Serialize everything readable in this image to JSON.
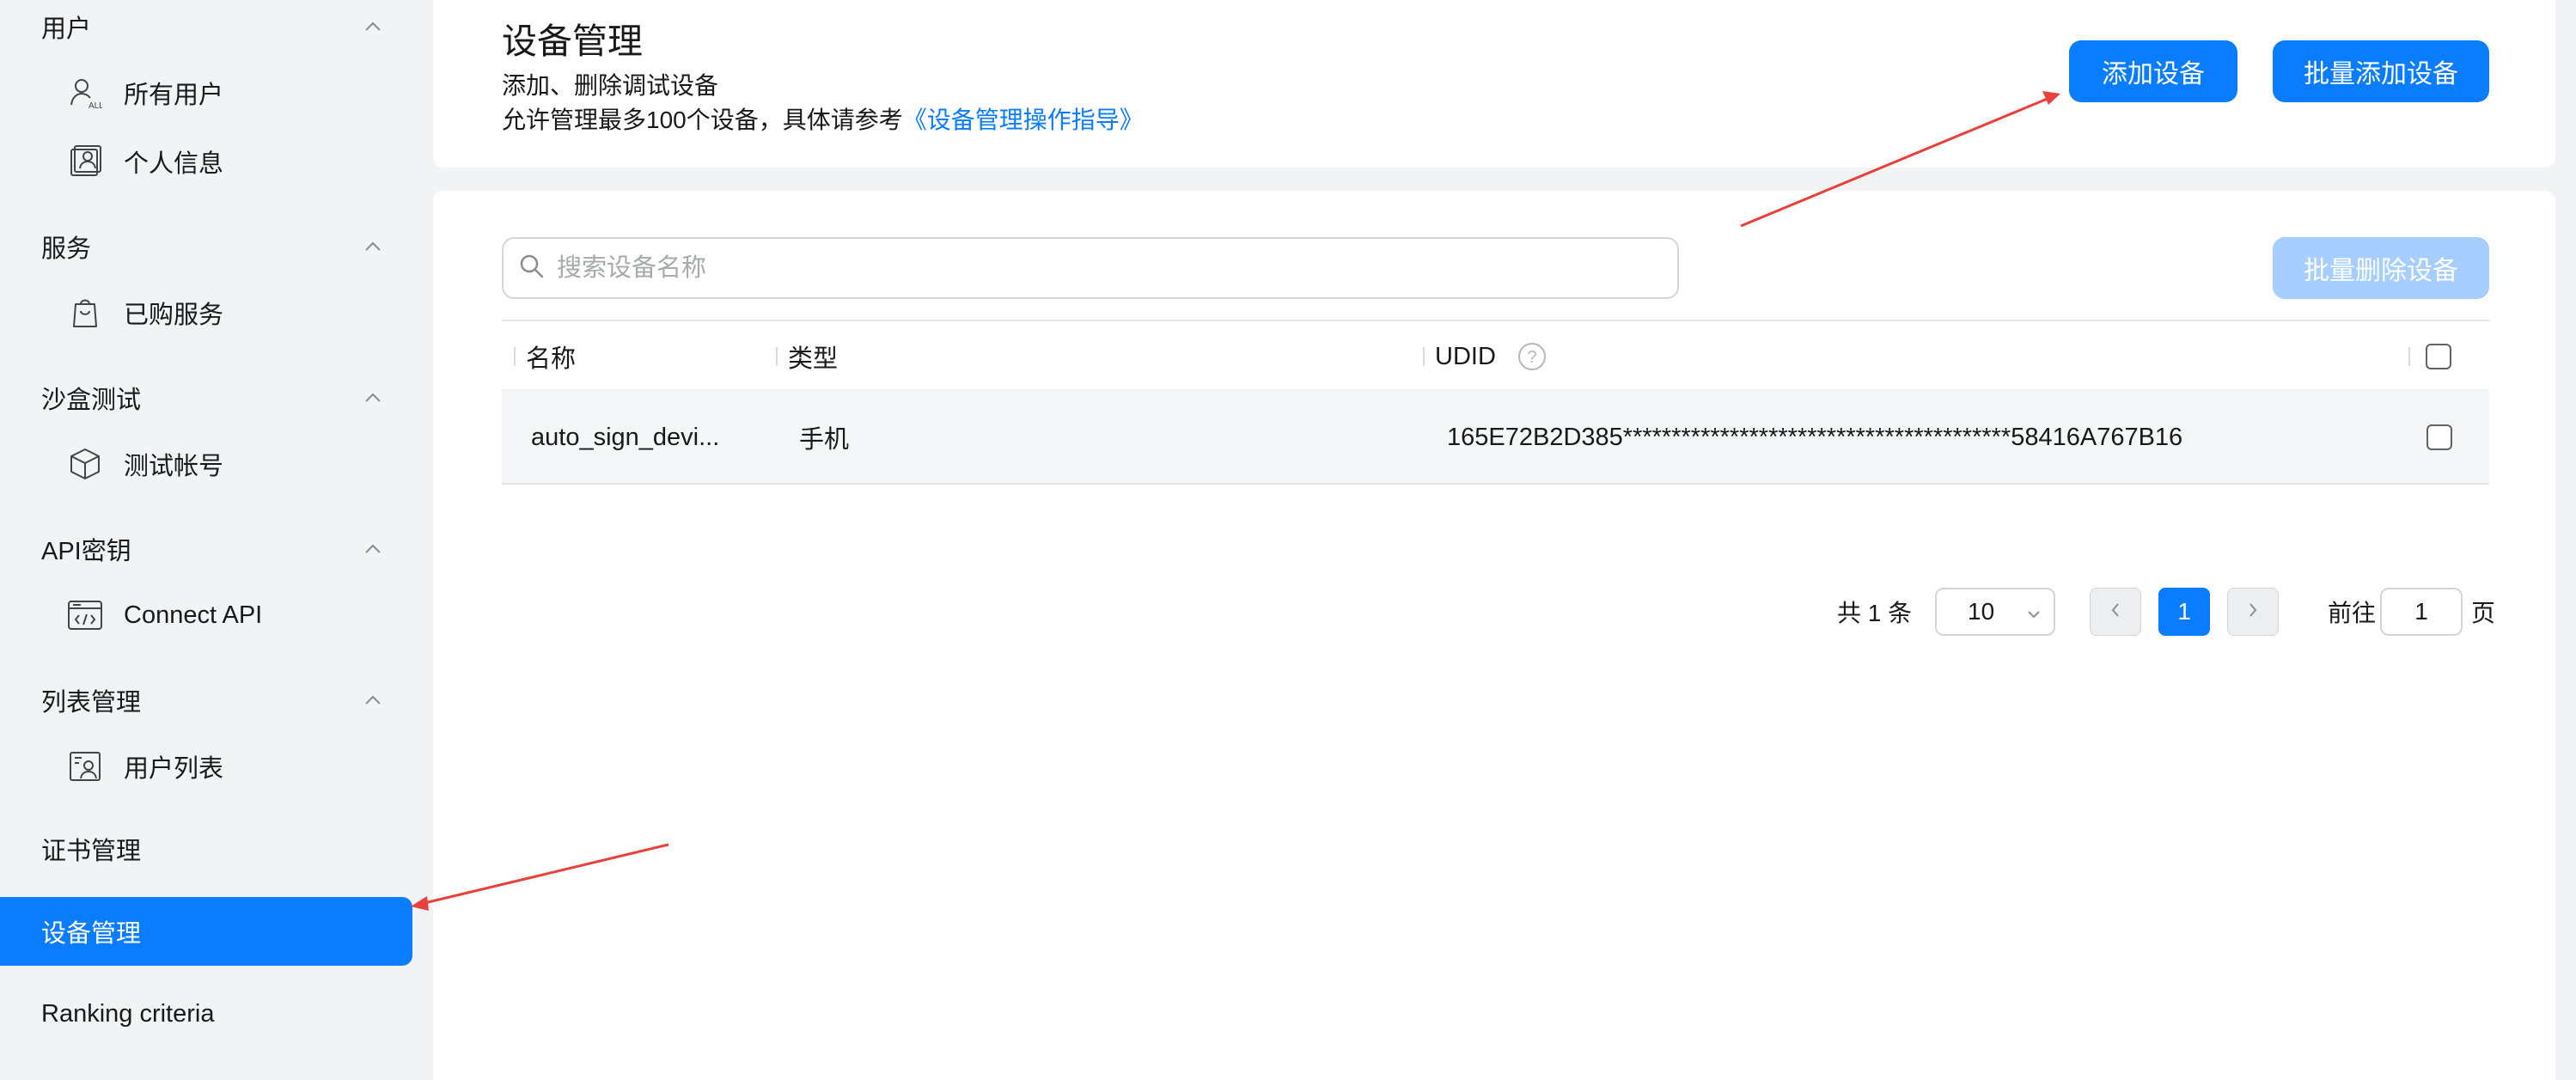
{
  "sidebar": {
    "groups": [
      {
        "label": "用户",
        "items": [
          {
            "label": "所有用户",
            "icon": "user-all-icon"
          },
          {
            "label": "个人信息",
            "icon": "profile-icon"
          }
        ]
      },
      {
        "label": "服务",
        "items": [
          {
            "label": "已购服务",
            "icon": "shopping-bag-icon"
          }
        ]
      },
      {
        "label": "沙盒测试",
        "items": [
          {
            "label": "测试帐号",
            "icon": "cube-icon"
          }
        ]
      },
      {
        "label": "API密钥",
        "items": [
          {
            "label": "Connect API",
            "icon": "code-window-icon"
          }
        ]
      },
      {
        "label": "列表管理",
        "items": [
          {
            "label": "用户列表",
            "icon": "user-list-icon"
          }
        ]
      }
    ],
    "flat_items": [
      {
        "label": "证书管理",
        "active": false
      },
      {
        "label": "设备管理",
        "active": true
      },
      {
        "label": "Ranking criteria",
        "active": false
      }
    ]
  },
  "header": {
    "title": "设备管理",
    "description": "添加、删除调试设备",
    "limit_text": "允许管理最多100个设备，具体请参考",
    "guide_link": "《设备管理操作指导》",
    "add_button": "添加设备",
    "batch_add_button": "批量添加设备"
  },
  "toolbar": {
    "search_placeholder": "搜索设备名称",
    "batch_delete_button": "批量删除设备"
  },
  "table": {
    "columns": [
      "名称",
      "类型",
      "UDID"
    ],
    "rows": [
      {
        "name": "auto_sign_devi...",
        "type": "手机",
        "udid": "165E72B2D385****************************************58416A767B16"
      }
    ]
  },
  "pagination": {
    "total_text": "共 1 条",
    "page_size": "10",
    "current_page": "1",
    "goto_prefix": "前往",
    "goto_value": "1",
    "goto_suffix": "页"
  },
  "colors": {
    "accent": "#0a7cff",
    "disabled_accent": "#a6cfff",
    "annotation_arrow": "#e8403a",
    "background": "#f1f3f5"
  }
}
